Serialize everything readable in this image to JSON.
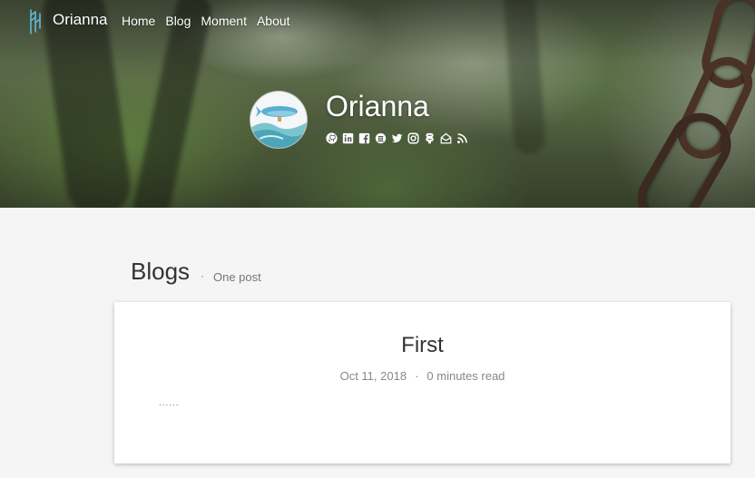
{
  "nav": {
    "brand": "Orianna",
    "links": [
      "Home",
      "Blog",
      "Moment",
      "About"
    ]
  },
  "profile": {
    "name": "Orianna",
    "social_icons": [
      "github-icon",
      "linkedin-icon",
      "facebook-icon",
      "douban-icon",
      "twitter-icon",
      "instagram-icon",
      "zhihu-icon",
      "email-icon",
      "rss-icon"
    ]
  },
  "main": {
    "section_title": "Blogs",
    "separator": "·",
    "post_count": "One post",
    "posts": [
      {
        "title": "First",
        "date": "Oct 11, 2018",
        "separator": "·",
        "read_time": "0 minutes read",
        "excerpt": "......"
      }
    ]
  },
  "colors": {
    "hero_overlay_text": "#ffffff",
    "body_background": "#f5f5f5",
    "card_background": "#ffffff",
    "heading_text": "#333333",
    "meta_text": "#888888"
  }
}
